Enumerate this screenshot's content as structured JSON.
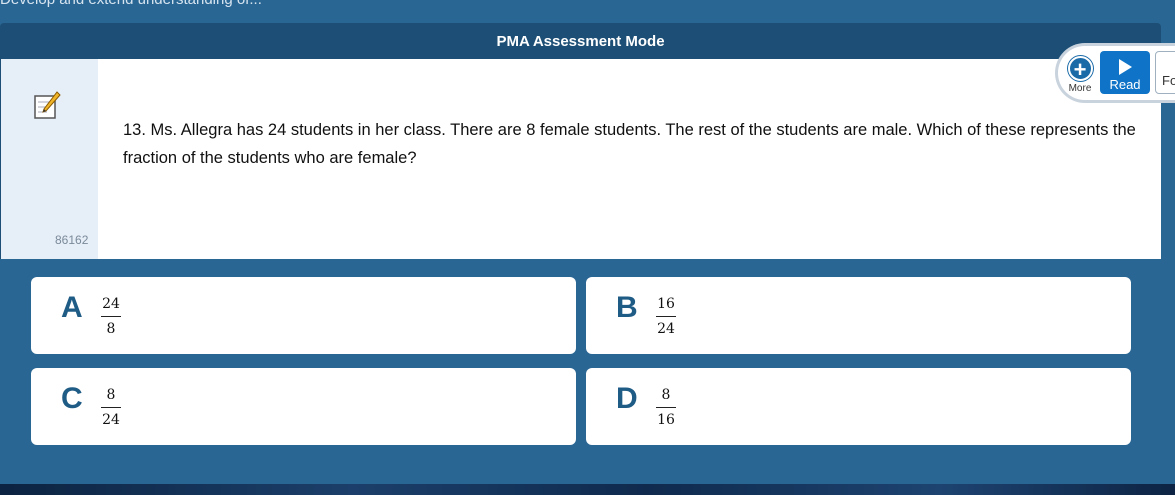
{
  "breadcrumb": "Develop and extend understanding of...",
  "header": {
    "title": "PMA Assessment Mode"
  },
  "question": {
    "text": "13.  Ms. Allegra has 24 students in her class.  There are 8 female students.  The rest of the students are male.  Which of these represents the fraction of the students who are female?",
    "item_id": "86162"
  },
  "toolbar": {
    "more_label": "More",
    "read_label": "Read",
    "next_label_partial": "Fo"
  },
  "answers": [
    {
      "letter": "A",
      "numerator": "24",
      "denominator": "8"
    },
    {
      "letter": "B",
      "numerator": "16",
      "denominator": "24"
    },
    {
      "letter": "C",
      "numerator": "8",
      "denominator": "24"
    },
    {
      "letter": "D",
      "numerator": "8",
      "denominator": "16"
    }
  ],
  "colors": {
    "background": "#2a6693",
    "header": "#1d4f76",
    "accent": "#0f74c7",
    "letter": "#1e5b85"
  }
}
